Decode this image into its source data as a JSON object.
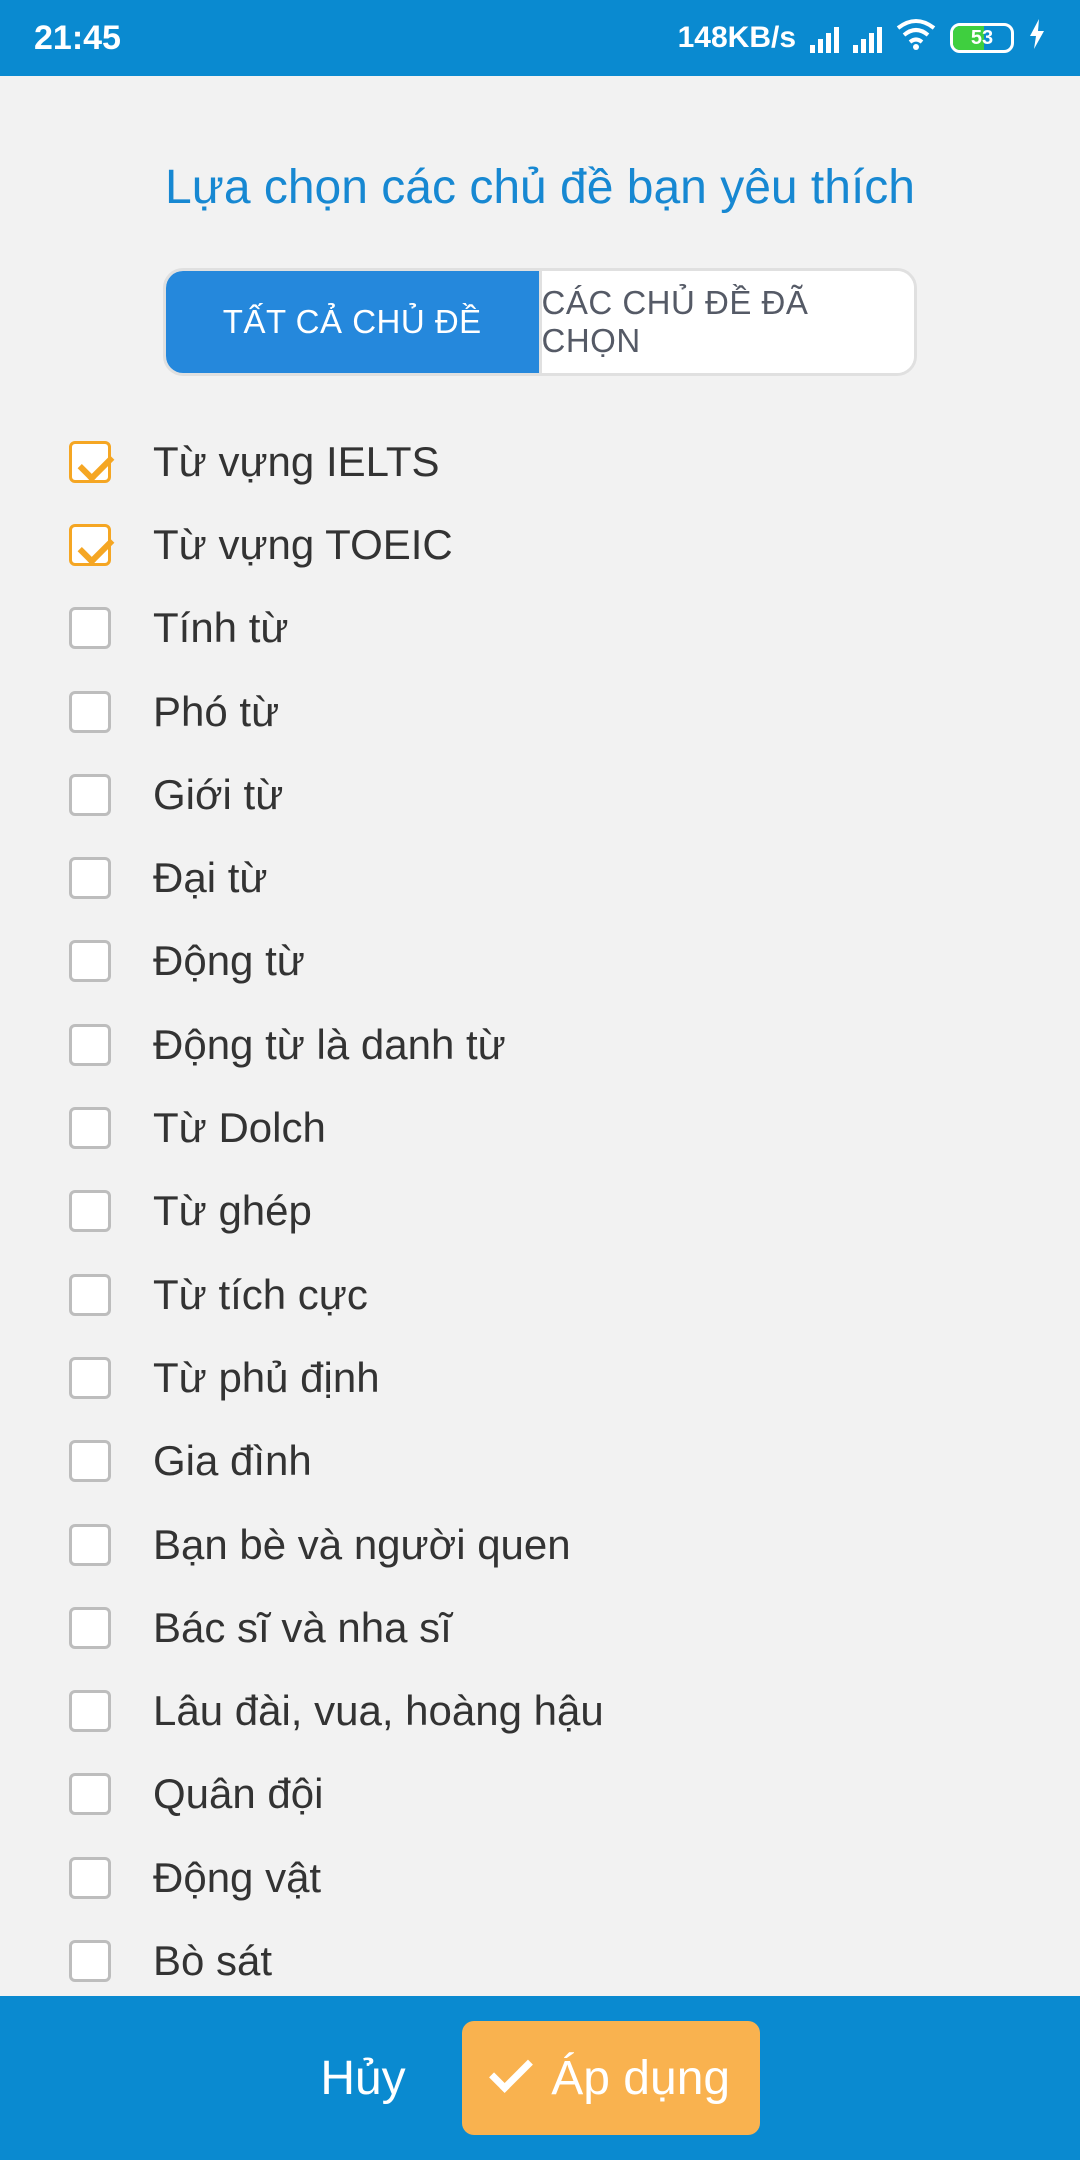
{
  "status_bar": {
    "time": "21:45",
    "network_speed": "148KB/s",
    "battery_level": "53",
    "icons": [
      "signal-icon",
      "signal-icon",
      "wifi-icon",
      "battery-icon",
      "charging-icon"
    ]
  },
  "title": "Lựa chọn các chủ đề bạn yêu thích",
  "tabs": [
    {
      "label": "TẤT CẢ CHỦ ĐỀ",
      "active": true
    },
    {
      "label": "CÁC CHỦ ĐỀ ĐÃ CHỌN",
      "active": false
    }
  ],
  "topics": [
    {
      "label": "Từ vựng IELTS",
      "checked": true
    },
    {
      "label": "Từ vựng TOEIC",
      "checked": true
    },
    {
      "label": "Tính từ",
      "checked": false
    },
    {
      "label": "Phó từ",
      "checked": false
    },
    {
      "label": "Giới từ",
      "checked": false
    },
    {
      "label": "Đại từ",
      "checked": false
    },
    {
      "label": "Động từ",
      "checked": false
    },
    {
      "label": "Động từ là danh từ",
      "checked": false
    },
    {
      "label": "Từ Dolch",
      "checked": false
    },
    {
      "label": "Từ ghép",
      "checked": false
    },
    {
      "label": "Từ tích cực",
      "checked": false
    },
    {
      "label": "Từ phủ định",
      "checked": false
    },
    {
      "label": "Gia đình",
      "checked": false
    },
    {
      "label": "Bạn bè và người quen",
      "checked": false
    },
    {
      "label": "Bác sĩ và nha sĩ",
      "checked": false
    },
    {
      "label": "Lâu đài, vua, hoàng hậu",
      "checked": false
    },
    {
      "label": "Quân đội",
      "checked": false
    },
    {
      "label": "Động vật",
      "checked": false
    },
    {
      "label": "Bò sát",
      "checked": false
    }
  ],
  "footer": {
    "cancel_label": "Hủy",
    "apply_label": "Áp dụng"
  },
  "colors": {
    "primary": "#0a8ad0",
    "accent": "#f9b24f",
    "checkbox_checked": "#f5a623"
  }
}
